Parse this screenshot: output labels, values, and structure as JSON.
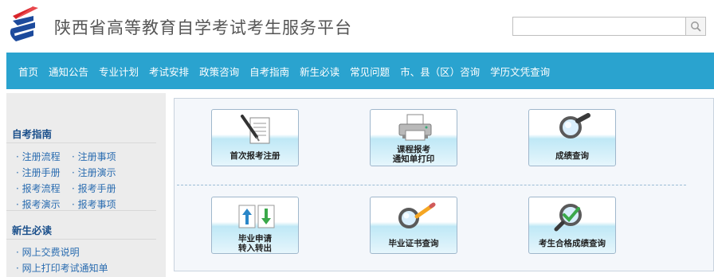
{
  "header": {
    "site_title": "陕西省高等教育自学考试考生服务平台",
    "search_placeholder": ""
  },
  "nav": {
    "items": [
      "首页",
      "通知公告",
      "专业计划",
      "考试安排",
      "政策咨询",
      "自考指南",
      "新生必读",
      "常见问题",
      "市、县（区）咨询",
      "学历文凭查询"
    ]
  },
  "sidebar": {
    "guide_title": "自考指南",
    "guide_links": [
      "注册流程",
      "注册事项",
      "注册手册",
      "注册演示",
      "报考流程",
      "报考手册",
      "报考演示",
      "报考事项"
    ],
    "newcomer_title": "新生必读",
    "newcomer_links": [
      "网上交费说明",
      "网上打印考试通知单"
    ]
  },
  "tiles": [
    {
      "label": "首次报考注册",
      "icon": "document-pen-icon"
    },
    {
      "label": "课程报考\n通知单打印",
      "icon": "printer-icon"
    },
    {
      "label": "成绩查询",
      "icon": "magnifier-icon"
    },
    {
      "label": "毕业申请\n转入转出",
      "icon": "transfer-arrows-icon"
    },
    {
      "label": "毕业证书查询",
      "icon": "magnifier-pencil-icon"
    },
    {
      "label": "考生合格成绩查询",
      "icon": "magnifier-check-icon"
    }
  ],
  "colors": {
    "nav_bg": "#2aa3cf",
    "sidebar_bg": "#ececec",
    "heading": "#1a4f8b",
    "link": "#2a6cb0",
    "logo_red": "#d9252b",
    "logo_blue": "#1c4a9c"
  }
}
